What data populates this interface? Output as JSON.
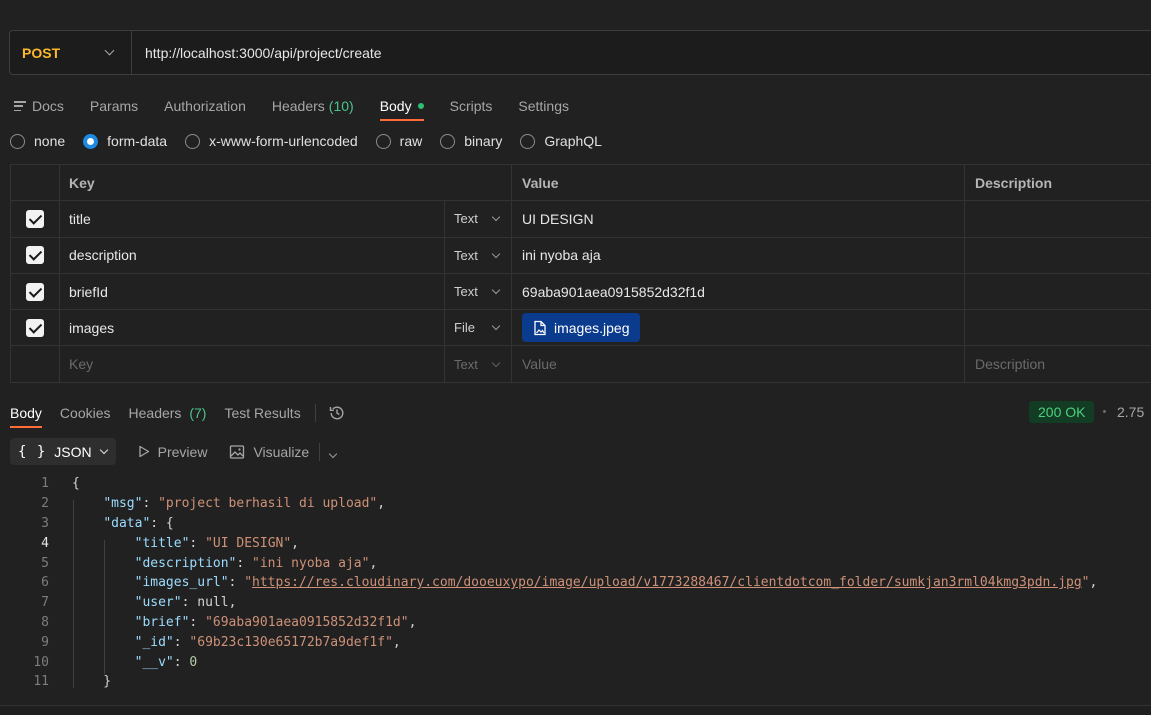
{
  "request": {
    "method": "POST",
    "url": "http://localhost:3000/api/project/create"
  },
  "request_tabs": [
    {
      "label": "Docs"
    },
    {
      "label": "Params"
    },
    {
      "label": "Authorization"
    },
    {
      "label": "Headers",
      "count": "(10)"
    },
    {
      "label": "Body",
      "active": true
    },
    {
      "label": "Scripts"
    },
    {
      "label": "Settings"
    }
  ],
  "body_types": [
    "none",
    "form-data",
    "x-www-form-urlencoded",
    "raw",
    "binary",
    "GraphQL"
  ],
  "body_type_selected": "form-data",
  "form_table": {
    "headers": {
      "key": "Key",
      "value": "Value",
      "description": "Description"
    },
    "rows": [
      {
        "key": "title",
        "type": "Text",
        "value": "UI DESIGN"
      },
      {
        "key": "description",
        "type": "Text",
        "value": "ini nyoba aja"
      },
      {
        "key": "briefId",
        "type": "Text",
        "value": "69aba901aea0915852d32f1d"
      },
      {
        "key": "images",
        "type": "File",
        "value": "images.jpeg"
      }
    ],
    "placeholder": {
      "key": "Key",
      "type": "Text",
      "value": "Value",
      "description": "Description"
    }
  },
  "response_tabs": [
    {
      "label": "Body",
      "active": true
    },
    {
      "label": "Cookies"
    },
    {
      "label": "Headers",
      "count": "(7)"
    },
    {
      "label": "Test Results"
    }
  ],
  "status": {
    "code": "200 OK",
    "time": "2.75"
  },
  "response_toolbar": {
    "format": "JSON",
    "preview": "Preview",
    "visualize": "Visualize"
  },
  "response_lines": [
    "1",
    "2",
    "3",
    "4",
    "5",
    "6",
    "7",
    "8",
    "9",
    "10",
    "11"
  ],
  "response_json": {
    "msg_key": "\"msg\"",
    "msg_val": "\"project berhasil di upload\"",
    "data_key": "\"data\"",
    "title_key": "\"title\"",
    "title_val": "\"UI DESIGN\"",
    "desc_key": "\"description\"",
    "desc_val": "\"ini nyoba aja\"",
    "images_key": "\"images_url\"",
    "images_url": "https://res.cloudinary.com/dooeuxypo/image/upload/v1773288467/clientdotcom_folder/sumkjan3rml04kmg3pdn.jpg",
    "user_key": "\"user\"",
    "user_val": "null",
    "brief_key": "\"brief\"",
    "brief_val": "\"69aba901aea0915852d32f1d\"",
    "id_key": "\"_id\"",
    "id_val": "\"69b23c130e65172b7a9def1f\"",
    "v_key": "\"__v\"",
    "v_val": "0"
  },
  "colors": {
    "accent": "#ff6c37",
    "method": "#fcb92c",
    "status_ok": "#4cd07d",
    "file_chip": "#0b3b8c"
  }
}
